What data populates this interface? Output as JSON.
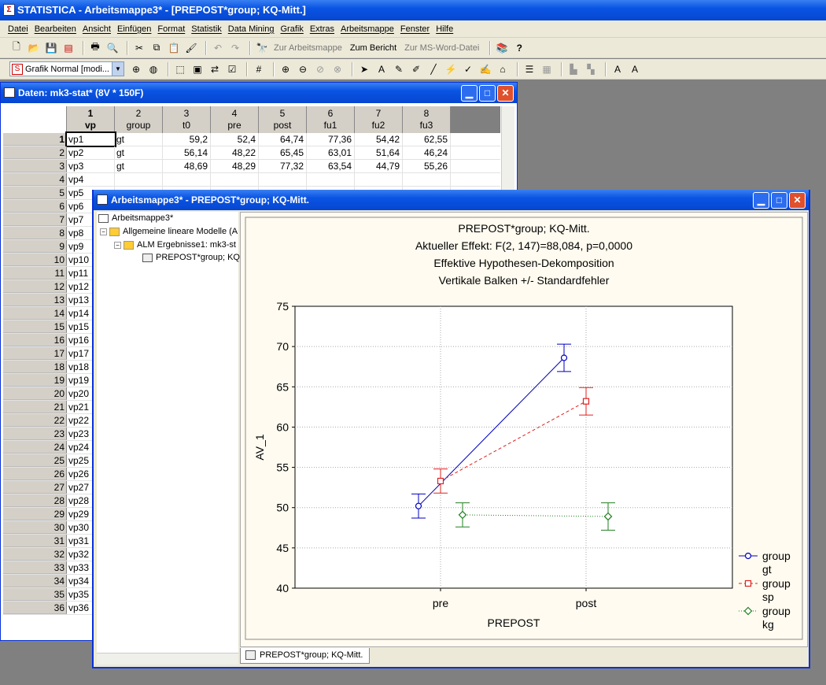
{
  "app": {
    "title": "STATISTICA - Arbeitsmappe3* - [PREPOST*group; KQ-Mitt.]",
    "icon_letter": "Σ"
  },
  "menu": [
    "Datei",
    "Bearbeiten",
    "Ansicht",
    "Einfügen",
    "Format",
    "Statistik",
    "Data Mining",
    "Grafik",
    "Extras",
    "Arbeitsmappe",
    "Fenster",
    "Hilfe"
  ],
  "toolbar1": {
    "zur_arbeitsmappe": "Zur Arbeitsmappe",
    "zum_bericht": "Zum Bericht",
    "zur_word": "Zur MS-Word-Datei"
  },
  "toolbar2": {
    "style_value": "Grafik Normal [modi...",
    "style_icon": "S"
  },
  "data_window": {
    "title": "Daten: mk3-stat* (8V * 150F)",
    "columns": [
      {
        "num": "1",
        "name": "vp"
      },
      {
        "num": "2",
        "name": "group"
      },
      {
        "num": "3",
        "name": "t0"
      },
      {
        "num": "4",
        "name": "pre"
      },
      {
        "num": "5",
        "name": "post"
      },
      {
        "num": "6",
        "name": "fu1"
      },
      {
        "num": "7",
        "name": "fu2"
      },
      {
        "num": "8",
        "name": "fu3"
      }
    ],
    "rows": [
      {
        "n": "1",
        "cells": [
          "vp1",
          "gt",
          "59,2",
          "52,4",
          "64,74",
          "77,36",
          "54,42",
          "62,55"
        ]
      },
      {
        "n": "2",
        "cells": [
          "vp2",
          "gt",
          "56,14",
          "48,22",
          "65,45",
          "63,01",
          "51,64",
          "46,24"
        ]
      },
      {
        "n": "3",
        "cells": [
          "vp3",
          "gt",
          "48,69",
          "48,29",
          "77,32",
          "63,54",
          "44,79",
          "55,26"
        ]
      },
      {
        "n": "4",
        "cells": [
          "vp4",
          "",
          "",
          "",
          "",
          "",
          "",
          ""
        ]
      },
      {
        "n": "5",
        "cells": [
          "vp5",
          "",
          "",
          "",
          "",
          "",
          "",
          ""
        ]
      },
      {
        "n": "6",
        "cells": [
          "vp6",
          "",
          "",
          "",
          "",
          "",
          "",
          ""
        ]
      },
      {
        "n": "7",
        "cells": [
          "vp7",
          "",
          "",
          "",
          "",
          "",
          "",
          ""
        ]
      },
      {
        "n": "8",
        "cells": [
          "vp8",
          "",
          "",
          "",
          "",
          "",
          "",
          ""
        ]
      },
      {
        "n": "9",
        "cells": [
          "vp9",
          "",
          "",
          "",
          "",
          "",
          "",
          ""
        ]
      },
      {
        "n": "10",
        "cells": [
          "vp10",
          "",
          "",
          "",
          "",
          "",
          "",
          ""
        ]
      },
      {
        "n": "11",
        "cells": [
          "vp11",
          "",
          "",
          "",
          "",
          "",
          "",
          ""
        ]
      },
      {
        "n": "12",
        "cells": [
          "vp12",
          "",
          "",
          "",
          "",
          "",
          "",
          ""
        ]
      },
      {
        "n": "13",
        "cells": [
          "vp13",
          "",
          "",
          "",
          "",
          "",
          "",
          ""
        ]
      },
      {
        "n": "14",
        "cells": [
          "vp14",
          "",
          "",
          "",
          "",
          "",
          "",
          ""
        ]
      },
      {
        "n": "15",
        "cells": [
          "vp15",
          "",
          "",
          "",
          "",
          "",
          "",
          ""
        ]
      },
      {
        "n": "16",
        "cells": [
          "vp16",
          "",
          "",
          "",
          "",
          "",
          "",
          ""
        ]
      },
      {
        "n": "17",
        "cells": [
          "vp17",
          "",
          "",
          "",
          "",
          "",
          "",
          ""
        ]
      },
      {
        "n": "18",
        "cells": [
          "vp18",
          "",
          "",
          "",
          "",
          "",
          "",
          ""
        ]
      },
      {
        "n": "19",
        "cells": [
          "vp19",
          "",
          "",
          "",
          "",
          "",
          "",
          ""
        ]
      },
      {
        "n": "20",
        "cells": [
          "vp20",
          "",
          "",
          "",
          "",
          "",
          "",
          ""
        ]
      },
      {
        "n": "21",
        "cells": [
          "vp21",
          "",
          "",
          "",
          "",
          "",
          "",
          ""
        ]
      },
      {
        "n": "22",
        "cells": [
          "vp22",
          "",
          "",
          "",
          "",
          "",
          "",
          ""
        ]
      },
      {
        "n": "23",
        "cells": [
          "vp23",
          "",
          "",
          "",
          "",
          "",
          "",
          ""
        ]
      },
      {
        "n": "24",
        "cells": [
          "vp24",
          "",
          "",
          "",
          "",
          "",
          "",
          ""
        ]
      },
      {
        "n": "25",
        "cells": [
          "vp25",
          "",
          "",
          "",
          "",
          "",
          "",
          ""
        ]
      },
      {
        "n": "26",
        "cells": [
          "vp26",
          "",
          "",
          "",
          "",
          "",
          "",
          ""
        ]
      },
      {
        "n": "27",
        "cells": [
          "vp27",
          "",
          "",
          "",
          "",
          "",
          "",
          ""
        ]
      },
      {
        "n": "28",
        "cells": [
          "vp28",
          "",
          "",
          "",
          "",
          "",
          "",
          ""
        ]
      },
      {
        "n": "29",
        "cells": [
          "vp29",
          "",
          "",
          "",
          "",
          "",
          "",
          ""
        ]
      },
      {
        "n": "30",
        "cells": [
          "vp30",
          "",
          "",
          "",
          "",
          "",
          "",
          ""
        ]
      },
      {
        "n": "31",
        "cells": [
          "vp31",
          "",
          "",
          "",
          "",
          "",
          "",
          ""
        ]
      },
      {
        "n": "32",
        "cells": [
          "vp32",
          "",
          "",
          "",
          "",
          "",
          "",
          ""
        ]
      },
      {
        "n": "33",
        "cells": [
          "vp33",
          "",
          "",
          "",
          "",
          "",
          "",
          ""
        ]
      },
      {
        "n": "34",
        "cells": [
          "vp34",
          "",
          "",
          "",
          "",
          "",
          "",
          ""
        ]
      },
      {
        "n": "35",
        "cells": [
          "vp35",
          "",
          "",
          "",
          "",
          "",
          "",
          ""
        ]
      },
      {
        "n": "36",
        "cells": [
          "vp36",
          "",
          "",
          "",
          "",
          "",
          "",
          ""
        ]
      }
    ]
  },
  "workbook_window": {
    "title": "Arbeitsmappe3* - PREPOST*group; KQ-Mitt.",
    "tree": {
      "root": "Arbeitsmappe3*",
      "level1": "Allgemeine lineare Modelle (A",
      "level2": "ALM Ergebnisse1: mk3-st",
      "level3": "PREPOST*group; KQ"
    },
    "tab_label": "PREPOST*group; KQ-Mitt."
  },
  "chart_data": {
    "type": "line",
    "title_lines": [
      "PREPOST*group; KQ-Mitt.",
      "Aktueller Effekt: F(2, 147)=88,084, p=0,0000",
      "Effektive Hypothesen-Dekomposition",
      "Vertikale Balken +/- Standardfehler"
    ],
    "xlabel": "PREPOST",
    "ylabel": "AV_1",
    "categories": [
      "pre",
      "post"
    ],
    "ylim": [
      40,
      75
    ],
    "yticks": [
      40,
      45,
      50,
      55,
      60,
      65,
      70,
      75
    ],
    "grid": true,
    "legend_position": "right",
    "series": [
      {
        "name": "group gt",
        "legend_line1": "group",
        "legend_line2": "gt",
        "color": "#0000c0",
        "marker": "circle",
        "dash": "solid",
        "values": [
          50.2,
          68.6
        ],
        "se": [
          1.5,
          1.7
        ]
      },
      {
        "name": "group sp",
        "legend_line1": "group",
        "legend_line2": "sp",
        "color": "#e02020",
        "marker": "square",
        "dash": "dashed",
        "values": [
          53.3,
          63.2
        ],
        "se": [
          1.5,
          1.7
        ]
      },
      {
        "name": "group kg",
        "legend_line1": "group",
        "legend_line2": "kg",
        "color": "#208020",
        "marker": "diamond",
        "dash": "dotted",
        "values": [
          49.1,
          48.9
        ],
        "se": [
          1.5,
          1.7
        ]
      }
    ]
  }
}
